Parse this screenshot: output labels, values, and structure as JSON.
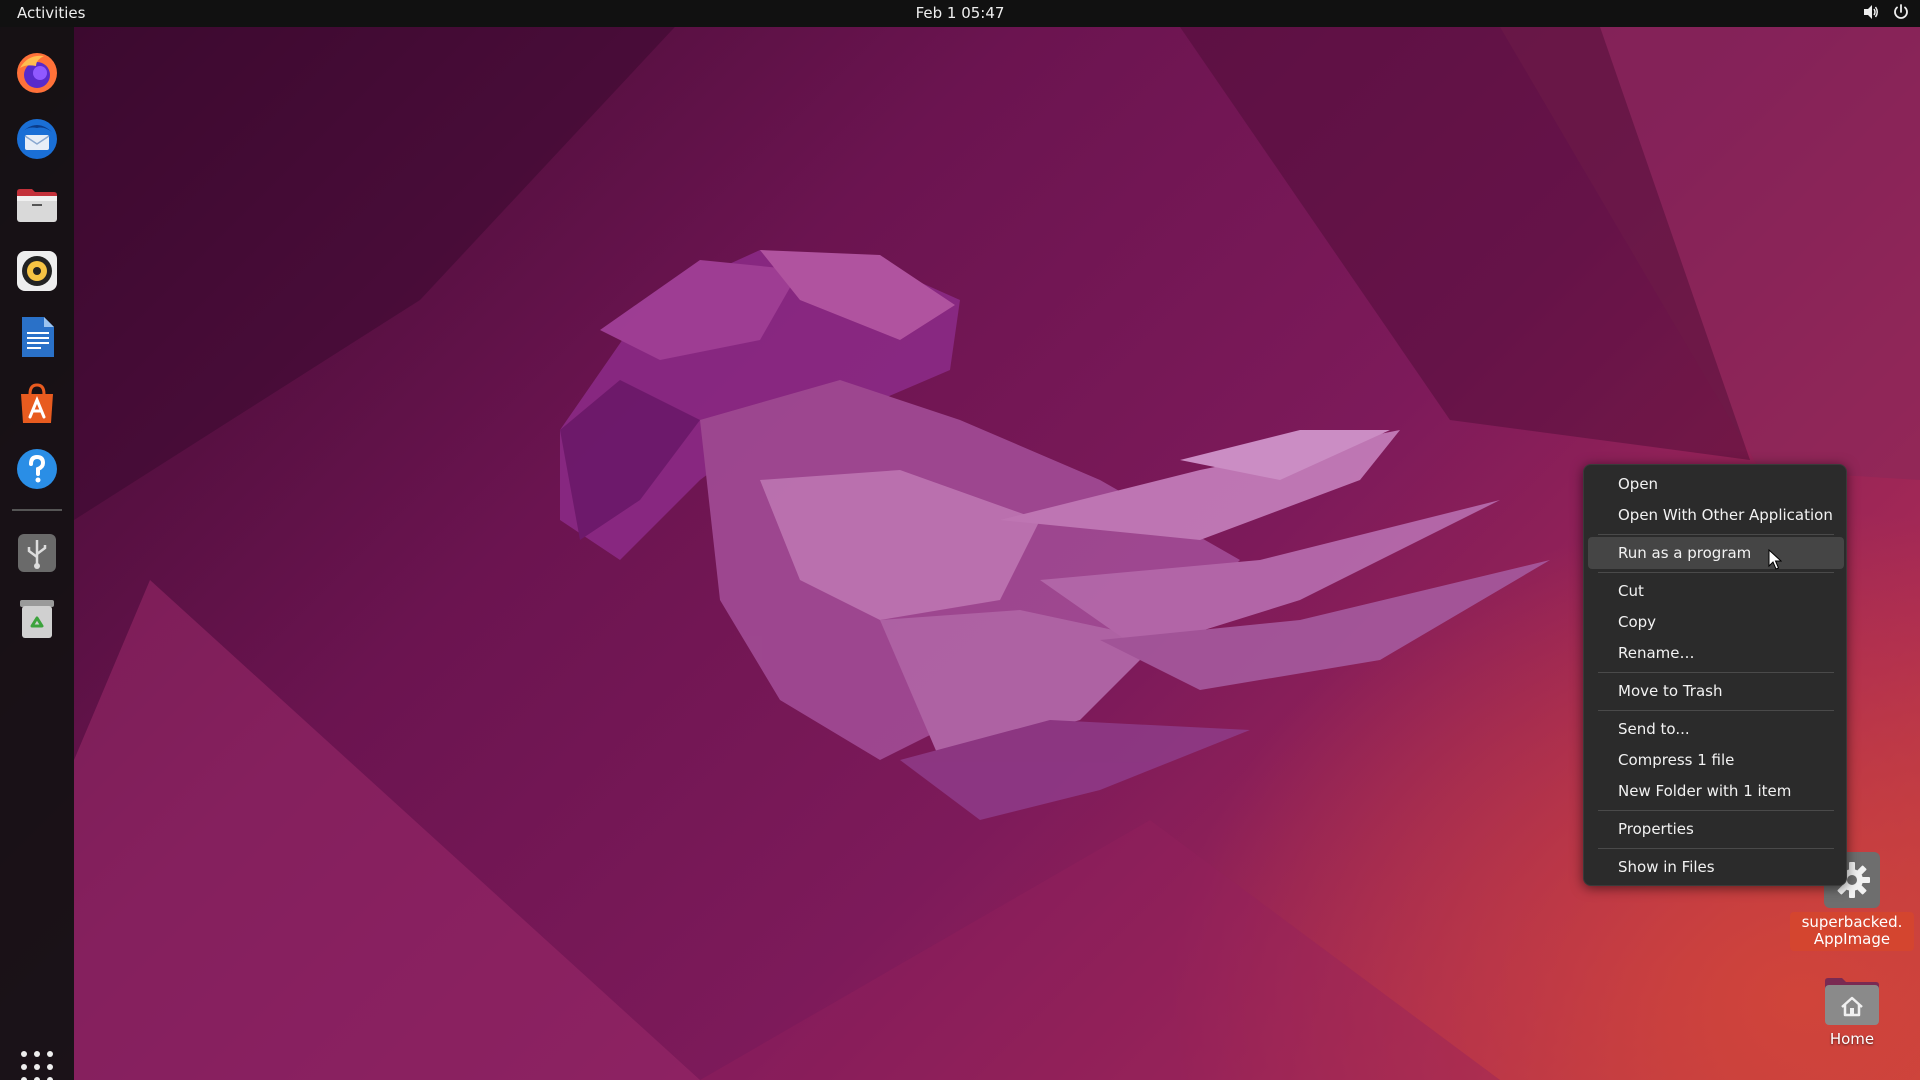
{
  "topbar": {
    "activities": "Activities",
    "clock": "Feb 1  05:47",
    "tray_icons": [
      "volume-icon",
      "power-icon"
    ]
  },
  "dock": {
    "items": [
      {
        "name": "firefox",
        "icon": "firefox-icon"
      },
      {
        "name": "thunderbird",
        "icon": "thunderbird-icon"
      },
      {
        "name": "files",
        "icon": "files-icon"
      },
      {
        "name": "rhythmbox",
        "icon": "rhythmbox-icon"
      },
      {
        "name": "libreoffice-writer",
        "icon": "writer-icon"
      },
      {
        "name": "ubuntu-software",
        "icon": "software-icon"
      },
      {
        "name": "help",
        "icon": "help-icon"
      },
      {
        "name": "usb-drive",
        "icon": "usb-icon"
      },
      {
        "name": "trash",
        "icon": "trash-icon"
      }
    ],
    "show_apps_icon": "apps-grid-icon"
  },
  "context_menu": {
    "items": [
      "Open",
      "Open With Other Application",
      "Run as a program",
      "Cut",
      "Copy",
      "Rename…",
      "Move to Trash",
      "Send to...",
      "Compress 1 file",
      "New Folder with 1 item",
      "Properties",
      "Show in Files"
    ],
    "highlighted": "Run as a program"
  },
  "desktop": {
    "appimage_label": "superbacked. AppImage",
    "home_label": "Home"
  },
  "colors": {
    "accent": "#d4452f",
    "menu_bg": "#2b2b2b",
    "topbar_bg": "#111111"
  }
}
